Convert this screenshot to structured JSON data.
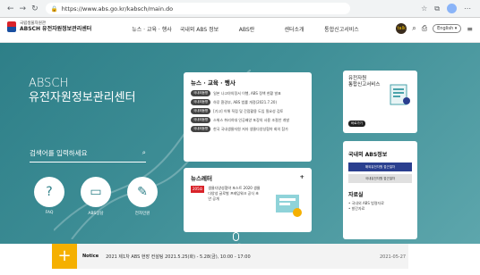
{
  "browser": {
    "url": "https://www.abs.go.kr/kabsch/main.do"
  },
  "header": {
    "logo_sub": "국립생물자원관",
    "logo_main": "ABSCH 유전자원정보관리센터",
    "nav": [
      "뉴스 · 교육 · 행사",
      "국내외 ABS 정보",
      "ABS란",
      "센터소개",
      "통합신고서비스"
    ],
    "lang": "English"
  },
  "hero": {
    "title_line1": "ABSCH",
    "title_line2": "유전자원정보관리센터",
    "search_placeholder": "검색어를 입력하세요",
    "quick": [
      {
        "label": "FAQ",
        "icon": "faq-icon"
      },
      {
        "label": "ABS상담",
        "icon": "consult-icon"
      },
      {
        "label": "전자민원",
        "icon": "e-petition-icon"
      }
    ],
    "scroll_label": "scroll"
  },
  "news": {
    "title": "뉴스 · 교육 · 행사",
    "more": "+",
    "items": [
      {
        "tag": "국내외동향",
        "text": "일본 나고야의정서 이행, ABS 정책 현황 발표"
      },
      {
        "tag": "국내외동향",
        "text": "하루 환경부, ABS 법률 개정(2021.7.20)"
      },
      {
        "tag": "국내외동향",
        "text": "[기고] 이해 직접 및 간접활용 도입 필요성 검토"
      },
      {
        "tag": "국내외동향",
        "text": "스위스 취리히대 인공배양 포장의 사용 조절안 개발"
      },
      {
        "tag": "국내외동향",
        "text": "한국 국내생물자원 저자 생물다양성협약 회의 참가"
      }
    ]
  },
  "letter": {
    "title": "뉴스레터",
    "more": "+",
    "tag": "205호",
    "text": "생물다양성협약 포스트 2020 생물다양성 글로벌 프레임워크 공식 초안 공개"
  },
  "report": {
    "title_line1": "유전자원",
    "title_line2": "통합신고서비스",
    "badge": "바로가기"
  },
  "abs": {
    "title": "국내외 ABS정보",
    "btn_primary": "해외유전자원 접근절차",
    "btn_secondary": "국내유전자원 접근절차",
    "res_title": "자료실",
    "res_items": [
      "• 국내외 ABS 법령자료",
      "• 발간자료"
    ]
  },
  "notice": {
    "label": "Notice",
    "text": "2021 제1차 ABS 현장 컨설팅 2021.5.25(화) - 5.28(금), 10:00 - 17:00",
    "date": "2021-05-27"
  },
  "colors": {
    "hero": "#3e8e96",
    "accent": "#f5b000",
    "primary_btn": "#2a3f8f"
  }
}
